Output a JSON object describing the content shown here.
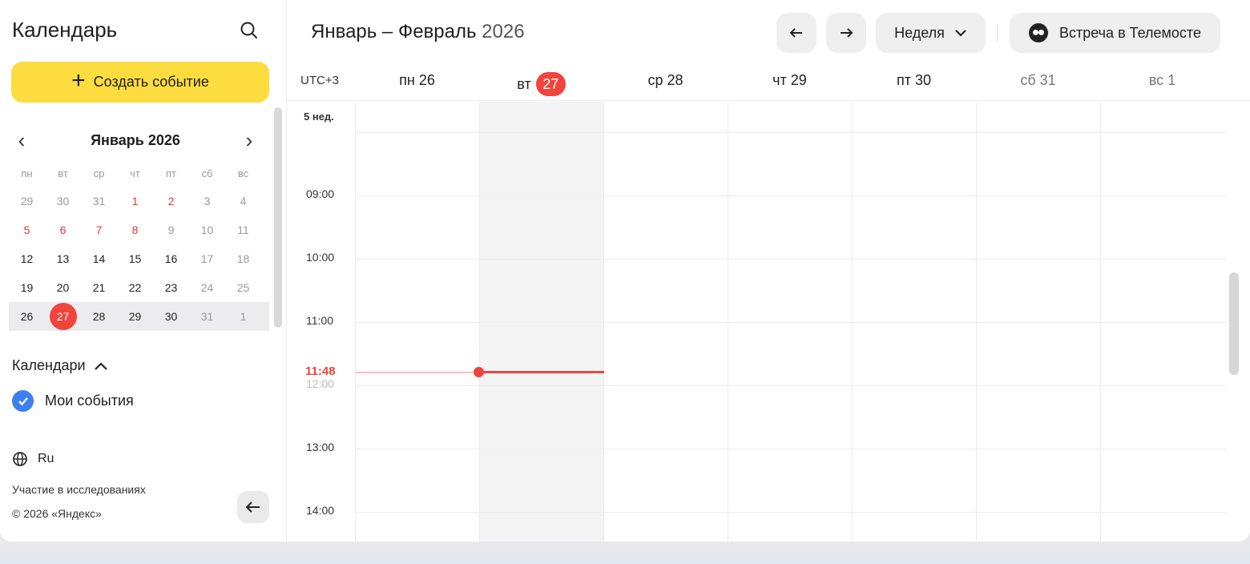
{
  "sidebar": {
    "title": "Календарь",
    "search_icon": "search-icon",
    "create_label": "Создать событие",
    "mini": {
      "month_title": "Январь 2026",
      "weekdays": [
        "пн",
        "вт",
        "ср",
        "чт",
        "пт",
        "сб",
        "вс"
      ],
      "weeks": [
        [
          "29",
          "30",
          "31",
          "1",
          "2",
          "3",
          "4"
        ],
        [
          "5",
          "6",
          "7",
          "8",
          "9",
          "10",
          "11"
        ],
        [
          "12",
          "13",
          "14",
          "15",
          "16",
          "17",
          "18"
        ],
        [
          "19",
          "20",
          "21",
          "22",
          "23",
          "24",
          "25"
        ],
        [
          "26",
          "27",
          "28",
          "29",
          "30",
          "31",
          "1"
        ]
      ],
      "today": "27"
    },
    "calendars_label": "Календари",
    "my_events_label": "Мои события",
    "language": "Ru",
    "research_link": "Участие в исследованиях",
    "copyright": "© 2026 «Яндекс»"
  },
  "main": {
    "period_months": "Январь – Февраль",
    "period_year": "2026",
    "view_label": "Неделя",
    "telemost_label": "Встреча в Телемосте",
    "timezone": "UTC+3",
    "days": [
      {
        "wd": "пн",
        "num": "26"
      },
      {
        "wd": "вт",
        "num": "27"
      },
      {
        "wd": "ср",
        "num": "28"
      },
      {
        "wd": "чт",
        "num": "29"
      },
      {
        "wd": "пт",
        "num": "30"
      },
      {
        "wd": "сб",
        "num": "31"
      },
      {
        "wd": "вс",
        "num": "1"
      }
    ],
    "week_label": "5 нед.",
    "hours": [
      "09:00",
      "10:00",
      "11:00",
      "12:00",
      "13:00",
      "14:00"
    ],
    "now_time": "11:48"
  },
  "colors": {
    "accent_yellow": "#fddc3f",
    "today_red": "#f0443c",
    "checkbox_blue": "#3d7ff0"
  }
}
